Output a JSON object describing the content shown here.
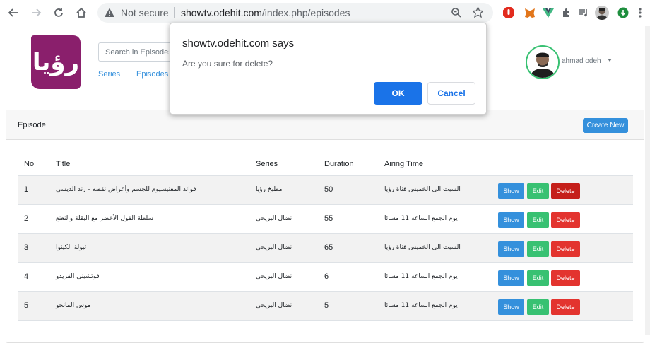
{
  "browser": {
    "not_secure": "Not secure",
    "url_host": "showtv.odehit.com",
    "url_path": "/index.php/episodes"
  },
  "navbar": {
    "logo_text": "رؤيا",
    "search_placeholder": "Search in Episodes",
    "links": [
      "Series",
      "Episodes"
    ],
    "user_name": "ahmad odeh"
  },
  "card": {
    "title": "Episode",
    "create_label": "Create New"
  },
  "table": {
    "headers": {
      "no": "No",
      "title": "Title",
      "series": "Series",
      "duration": "Duration",
      "airing": "Airing Time"
    },
    "rows": [
      {
        "no": "1",
        "title": "فوائد المغنيسيوم للجسم وأعراض نقصه - رند الديسي",
        "series": "مطبخ رؤيا",
        "duration": "50",
        "airing": "السبت الى الخميس قناة رؤيا"
      },
      {
        "no": "2",
        "title": "سلطة الفول الأخضر مع البقلة والنعنع",
        "series": "نضال البريحي",
        "duration": "55",
        "airing": "يوم الجمع الساعه 11 مسائا"
      },
      {
        "no": "3",
        "title": "تبولة الكينوا",
        "series": "نضال البريحي",
        "duration": "65",
        "airing": "السبت الى الخميس قناة رؤيا"
      },
      {
        "no": "4",
        "title": "فوتشيني الفريدو",
        "series": "نضال البريحي",
        "duration": "6",
        "airing": "يوم الجمع الساعه 11 مسائا"
      },
      {
        "no": "5",
        "title": "موس المانجو",
        "series": "نضال البريحي",
        "duration": "5",
        "airing": "يوم الجمع الساعه 11 مسائا"
      }
    ],
    "actions": {
      "show": "Show",
      "edit": "Edit",
      "delete": "Delete"
    }
  },
  "dialog": {
    "title": "showtv.odehit.com says",
    "message": "Are you sure for delete?",
    "ok": "OK",
    "cancel": "Cancel"
  },
  "colors": {
    "primary": "#3490dc",
    "success": "#38c172",
    "danger": "#e3342f",
    "brand": "#8a1f6c",
    "dialog_accent": "#1a73e8"
  }
}
